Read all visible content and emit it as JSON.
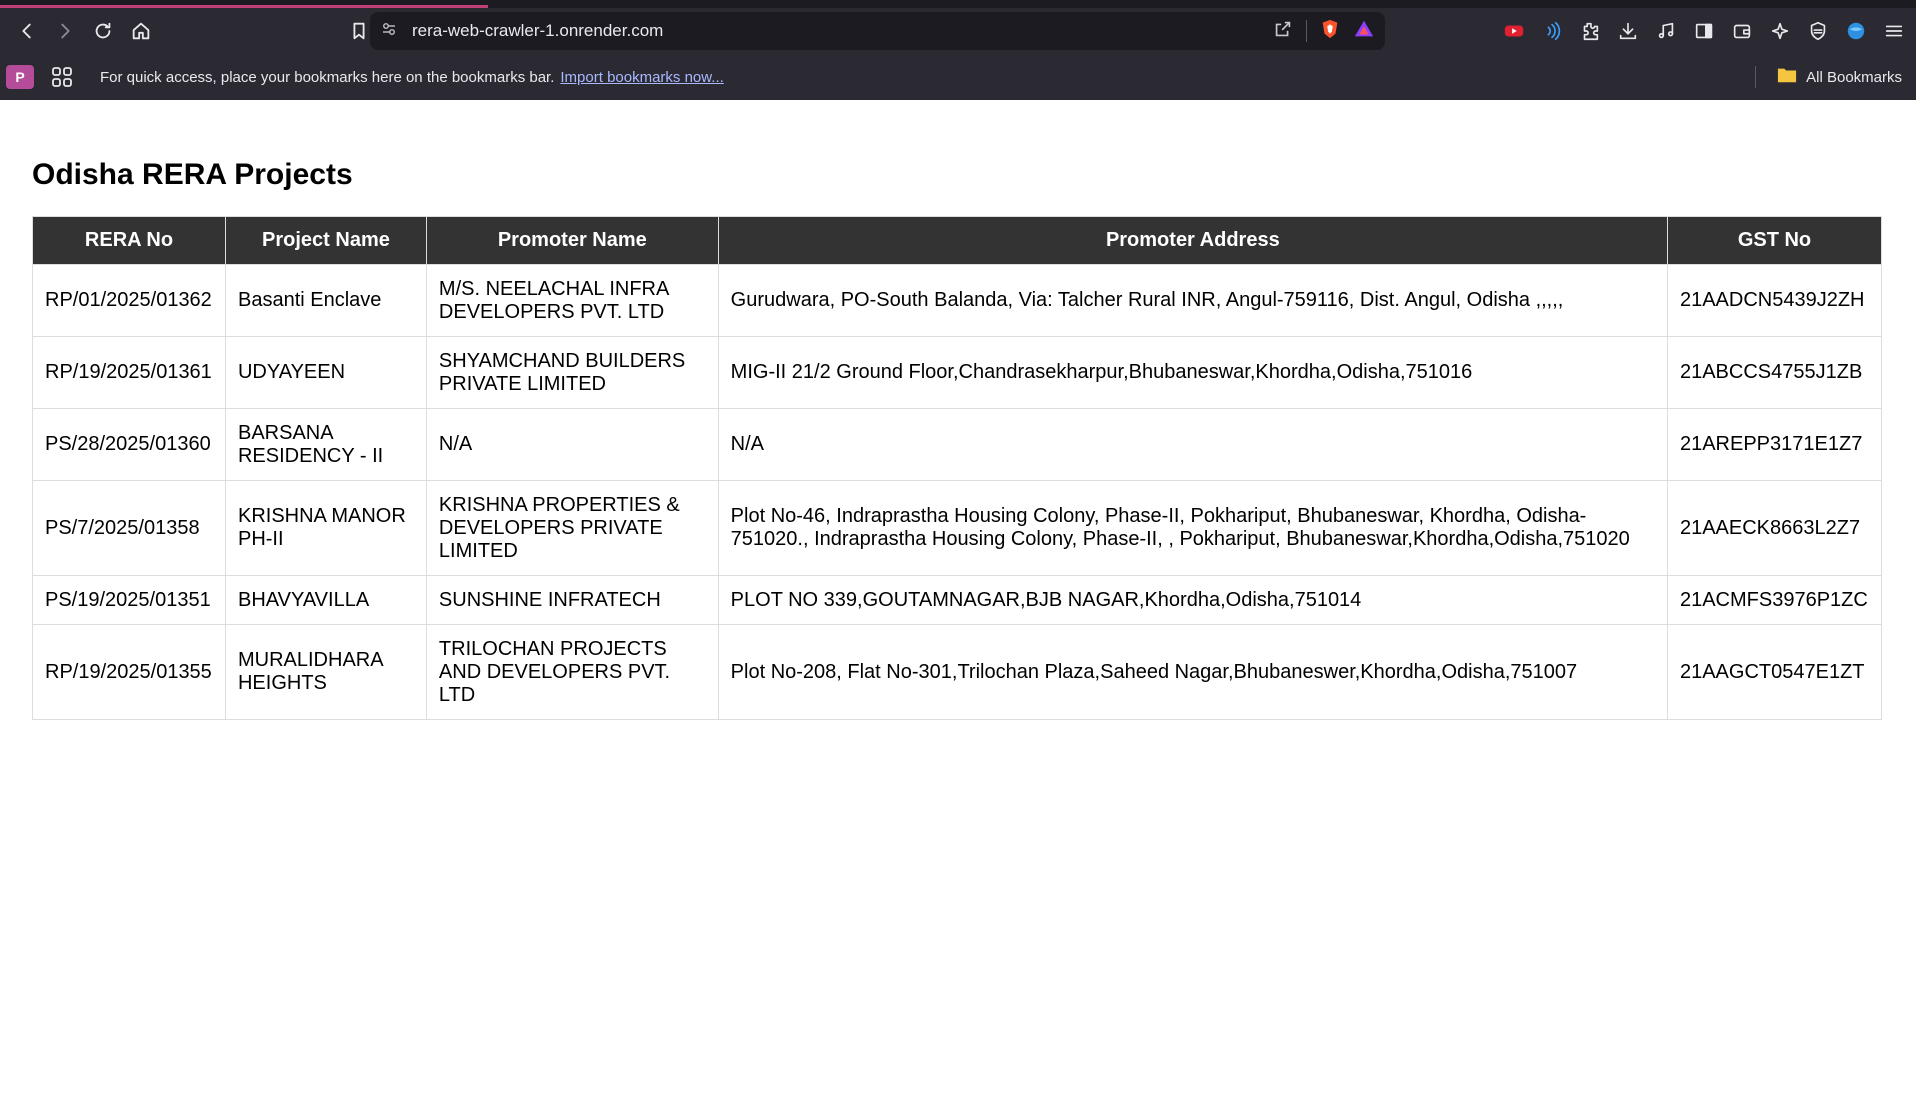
{
  "browser": {
    "url": "rera-web-crawler-1.onrender.com",
    "bookmarks_bar": {
      "profile_initial": "P",
      "message": "For quick access, place your bookmarks here on the bookmarks bar.",
      "import_link": "Import bookmarks now...",
      "all_bookmarks": "All Bookmarks"
    },
    "icons": [
      "back-icon",
      "forward-icon",
      "reload-icon",
      "home-icon",
      "bookmark-icon",
      "site-settings-icon",
      "share-icon",
      "brave-shield-icon",
      "brave-rewards-icon",
      "youtube-extension-icon",
      "wireless-icon",
      "extensions-icon",
      "download-icon",
      "media-icon",
      "sidebar-icon",
      "wallet-icon",
      "leo-ai-icon",
      "vpn-icon",
      "profile-globe-icon",
      "menu-icon"
    ]
  },
  "page": {
    "title": "Odisha RERA Projects",
    "table": {
      "headers": [
        "RERA No",
        "Project Name",
        "Promoter Name",
        "Promoter Address",
        "GST No"
      ],
      "rows": [
        [
          "RP/01/2025/01362",
          "Basanti Enclave",
          "M/S. NEELACHAL INFRA DEVELOPERS PVT. LTD",
          "Gurudwara, PO-South Balanda, Via: Talcher Rural INR, Angul-759116, Dist. Angul, Odisha ,,,,,",
          "21AADCN5439J2ZH"
        ],
        [
          "RP/19/2025/01361",
          "UDYAYEEN",
          "SHYAMCHAND BUILDERS PRIVATE LIMITED",
          "MIG-II 21/2 Ground Floor,Chandrasekharpur,Bhubaneswar,Khordha,Odisha,751016",
          "21ABCCS4755J1ZB"
        ],
        [
          "PS/28/2025/01360",
          "BARSANA RESIDENCY - II",
          "N/A",
          "N/A",
          "21AREPP3171E1Z7"
        ],
        [
          "PS/7/2025/01358",
          "KRISHNA MANOR PH-II",
          "KRISHNA PROPERTIES & DEVELOPERS PRIVATE LIMITED",
          "Plot No-46, Indraprastha Housing Colony, Phase-II, Pokhariput, Bhubaneswar, Khordha, Odisha-751020., Indraprastha Housing Colony, Phase-II, , Pokhariput, Bhubaneswar,Khordha,Odisha,751020",
          "21AAECK8663L2Z7"
        ],
        [
          "PS/19/2025/01351",
          "BHAVYAVILLA",
          "SUNSHINE INFRATECH",
          "PLOT NO 339,GOUTAMNAGAR,BJB NAGAR,Khordha,Odisha,751014",
          "21ACMFS3976P1ZC"
        ],
        [
          "RP/19/2025/01355",
          "MURALIDHARA HEIGHTS",
          "TRILOCHAN PROJECTS AND DEVELOPERS PVT. LTD",
          "Plot No-208, Flat No-301,Trilochan Plaza,Saheed Nagar,Bhubaneswer,Khordha,Odisha,751007",
          "21AAGCT0547E1ZT"
        ]
      ]
    }
  }
}
